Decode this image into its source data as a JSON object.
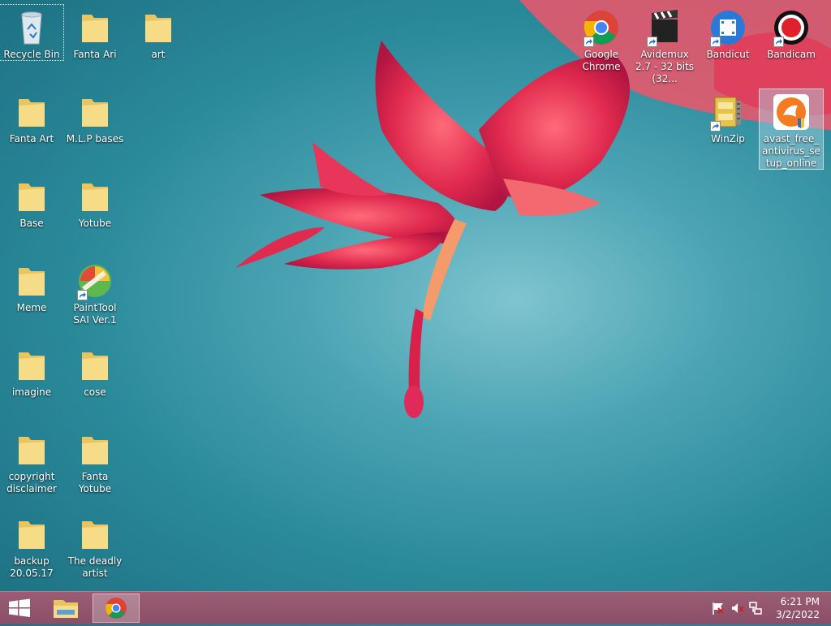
{
  "desktop": {
    "icons_left": [
      {
        "label": "Recycle Bin",
        "icon": "recycle-bin-icon"
      },
      {
        "label": "Fanta Ari",
        "icon": "folder-icon"
      },
      {
        "label": "art",
        "icon": "folder-icon"
      },
      {
        "label": "Fanta Art",
        "icon": "folder-icon"
      },
      {
        "label": "M.L.P bases",
        "icon": "folder-icon"
      },
      {
        "label": "Base",
        "icon": "folder-icon"
      },
      {
        "label": "Yotube",
        "icon": "folder-icon"
      },
      {
        "label": "Meme",
        "icon": "folder-icon"
      },
      {
        "label": "PaintTool SAI Ver.1",
        "icon": "painttool-sai-icon"
      },
      {
        "label": "imagine",
        "icon": "folder-icon"
      },
      {
        "label": "cose",
        "icon": "folder-icon"
      },
      {
        "label": "copyright disclaimer",
        "icon": "folder-icon"
      },
      {
        "label": "Fanta Yotube",
        "icon": "folder-icon"
      },
      {
        "label": "backup 20.05.17",
        "icon": "folder-icon"
      },
      {
        "label": "The deadly artist",
        "icon": "folder-icon"
      }
    ],
    "icons_right": [
      {
        "label": "Google Chrome",
        "icon": "chrome-icon"
      },
      {
        "label": "Avidemux 2.7 - 32 bits (32...",
        "icon": "avidemux-icon"
      },
      {
        "label": "Bandicut",
        "icon": "bandicut-icon"
      },
      {
        "label": "Bandicam",
        "icon": "bandicam-icon"
      },
      {
        "label": "WinZip",
        "icon": "winzip-icon"
      },
      {
        "label": "avast_free_antivirus_setup_online",
        "icon": "avast-icon"
      }
    ]
  },
  "taskbar": {
    "start": "windows-logo-icon",
    "pinned": [
      "file-explorer-icon",
      "chrome-icon"
    ],
    "tray": [
      "action-center-flag-icon",
      "volume-muted-icon",
      "network-icon"
    ],
    "clock": {
      "time": "6:21 PM",
      "date": "3/2/2022"
    }
  }
}
